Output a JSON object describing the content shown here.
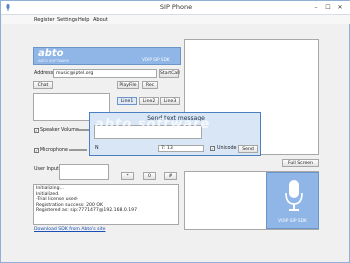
{
  "window": {
    "title": "SIP Phone",
    "min": "–",
    "max": "☐",
    "close": "✕"
  },
  "menu": [
    "Register",
    "Settings",
    "Help",
    "About"
  ],
  "banner": {
    "brand": "abto",
    "brand_sub": "ABTO SOFTWARE",
    "product": "VOIP SIP SDK"
  },
  "address": {
    "label": "Address:",
    "value": "music@iptel.org",
    "button": "StartCall"
  },
  "buttons": {
    "chat": "Chat",
    "playfile": "PlayFile",
    "rec": "Rec"
  },
  "lines": [
    "Line1",
    "Line2",
    "Line3"
  ],
  "keypad": [
    "*",
    "0",
    "#"
  ],
  "volume": {
    "speaker": "Speaker Volume",
    "mic": "Microphone",
    "user_input": "User Input"
  },
  "log": [
    "Initializing...",
    "Initialized.",
    "-Trial license used-",
    "Registration success: 200 OK",
    "Registered as: sip:7771477@192.168.0.197"
  ],
  "footer_link": "Download SDK from Abto's site",
  "right": {
    "fullscreen": "Full Screen",
    "logo_product": "VOIP SIP SDK"
  },
  "dialog": {
    "title": "Send text message",
    "to_label": "N",
    "number": "7: 13",
    "unicode": "Unicode",
    "send": "Send"
  },
  "watermark": "abto software",
  "colors": {
    "accent": "#8fb6e6",
    "dialog": "#d8e6f6",
    "link": "#1a4fb5"
  }
}
